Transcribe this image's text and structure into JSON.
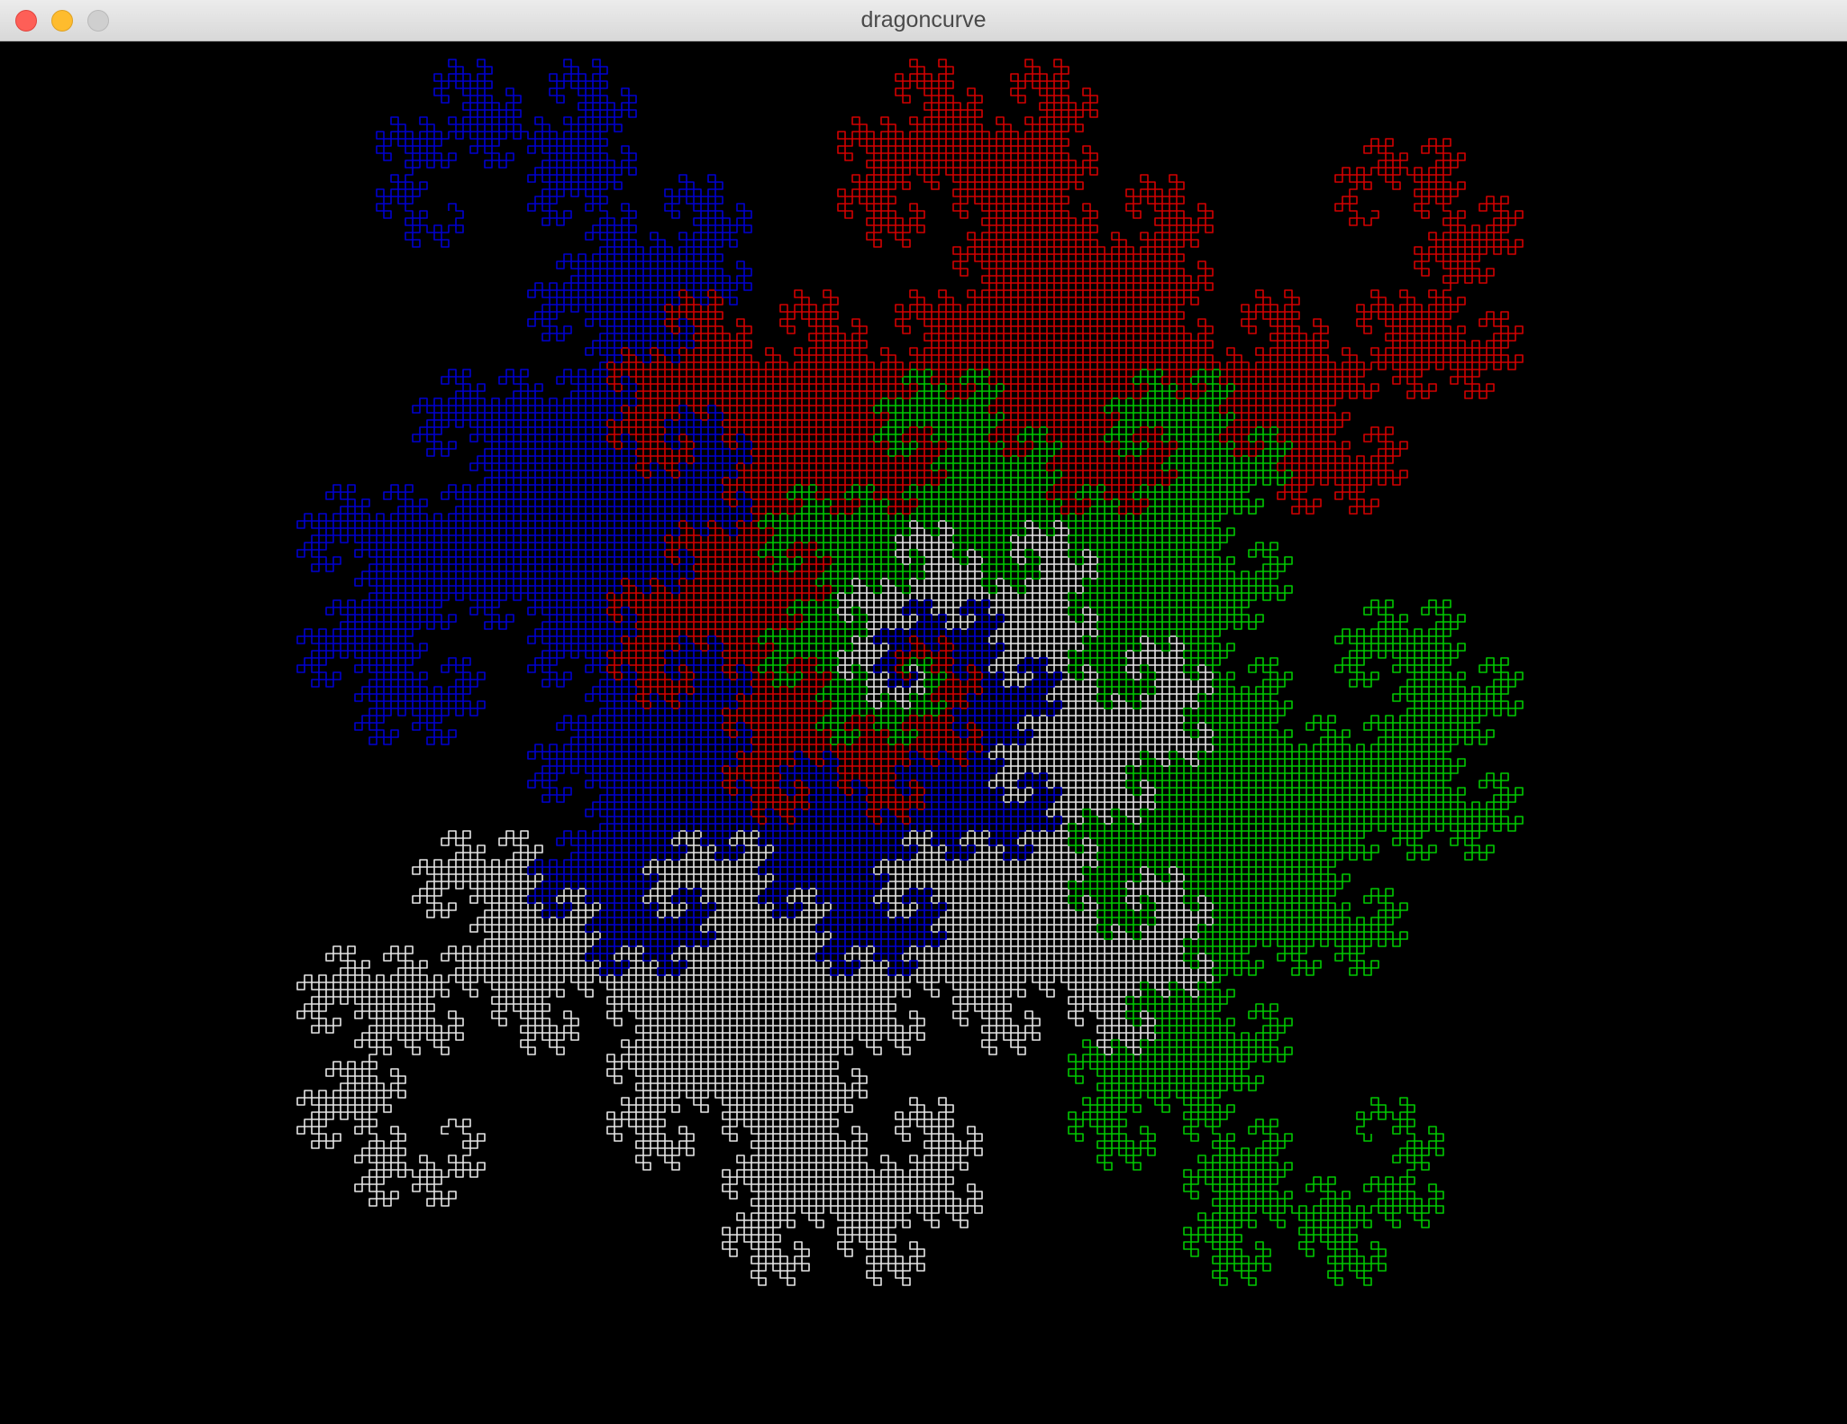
{
  "window": {
    "title": "dragoncurve",
    "background_color": "#000000"
  },
  "titlebar_buttons": [
    {
      "name": "close-button",
      "color": "#fe5f57"
    },
    {
      "name": "minimize-button",
      "color": "#febc2e"
    },
    {
      "name": "zoom-button",
      "color": "#cfcfcf"
    }
  ],
  "dragon_curves": [
    {
      "name": "white",
      "color": "#e6e6e6",
      "order": 13
    },
    {
      "name": "green",
      "color": "#00c800",
      "order": 13
    },
    {
      "name": "red",
      "color": "#d20000",
      "order": 13
    },
    {
      "name": "blue",
      "color": "#0000d0",
      "order": 13
    }
  ]
}
